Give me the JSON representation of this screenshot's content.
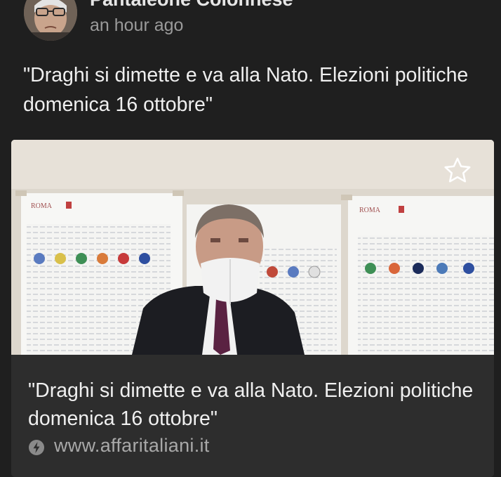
{
  "post": {
    "author_name": "Pantaleone Colonnese",
    "timestamp": "an hour ago",
    "text": "\"Draghi si dimette e va alla Nato. Elezioni politiche domenica 16 ottobre\""
  },
  "link_card": {
    "title": "\"Draghi si dimette e va alla Nato. Elezioni politiche domenica 16 ottobre\"",
    "source_url": "www.affaritaliani.it",
    "image_signs": [
      "ROMA",
      "ROMA"
    ],
    "icons": {
      "favorite": "star-outline-icon",
      "source": "lightning-bolt-icon"
    }
  },
  "colors": {
    "background": "#1f1f1f",
    "card": "#2d2d2d",
    "text": "#efefef",
    "secondary_text": "#9a9a9a"
  }
}
